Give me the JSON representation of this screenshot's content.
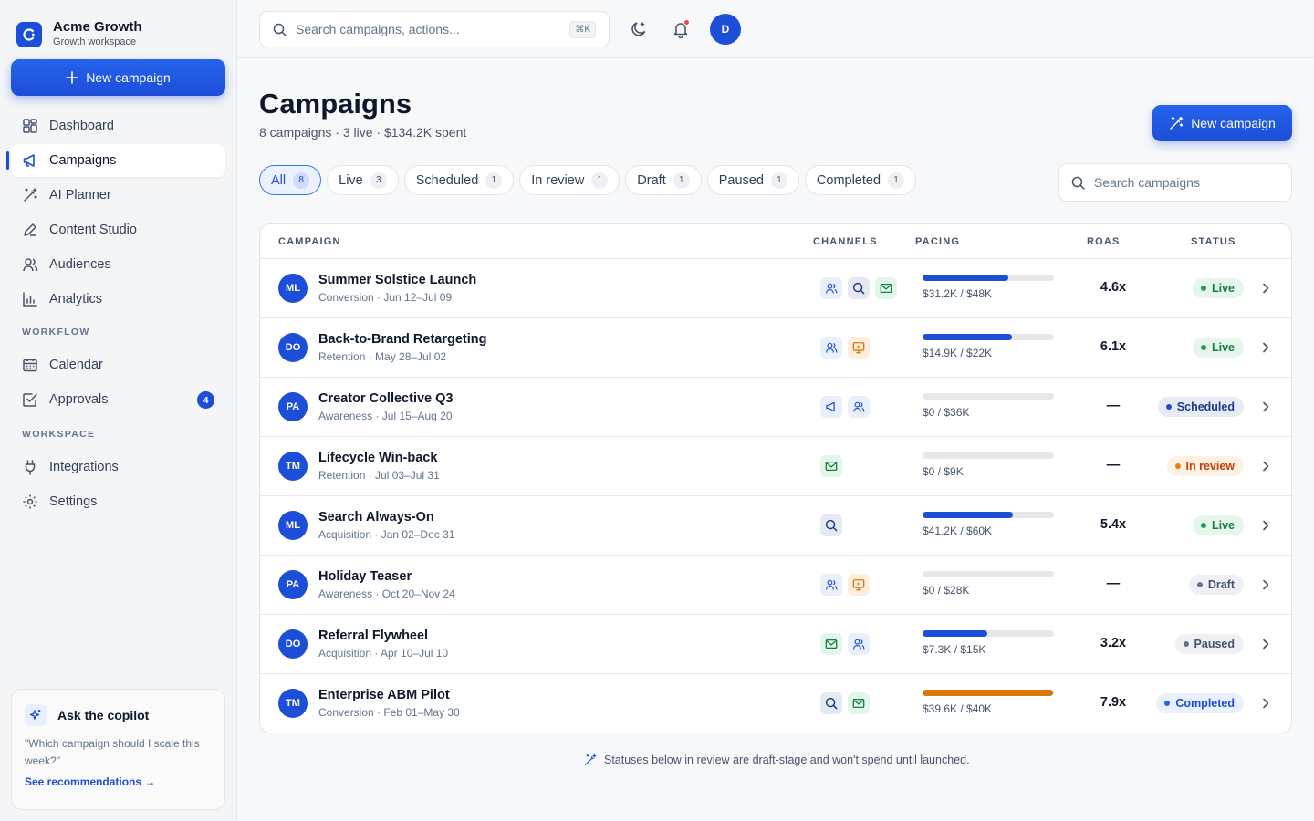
{
  "brand": {
    "name": "Acme Growth",
    "workspace": "Growth workspace"
  },
  "sidebar": {
    "new_campaign_label": "New campaign",
    "main_items": [
      {
        "label": "Dashboard",
        "icon": "dashboard-icon"
      },
      {
        "label": "Campaigns",
        "icon": "megaphone-icon",
        "active": true
      },
      {
        "label": "AI Planner",
        "icon": "magic-wand-icon"
      },
      {
        "label": "Content Studio",
        "icon": "pen-icon"
      },
      {
        "label": "Audiences",
        "icon": "users-icon"
      },
      {
        "label": "Analytics",
        "icon": "bar-chart-icon"
      }
    ],
    "workflow_title": "WORKFLOW",
    "workflow_items": [
      {
        "label": "Calendar",
        "icon": "calendar-icon"
      },
      {
        "label": "Approvals",
        "icon": "check-square-icon",
        "badge": "4"
      }
    ],
    "workspace_title": "WORKSPACE",
    "workspace_items": [
      {
        "label": "Integrations",
        "icon": "plug-icon"
      },
      {
        "label": "Settings",
        "icon": "gear-icon"
      }
    ],
    "copilot": {
      "title": "Ask the copilot",
      "prompt": "\"Which campaign should I scale this week?\"",
      "link": "See recommendations →"
    }
  },
  "topbar": {
    "search_placeholder": "Search campaigns, actions...",
    "shortcut": "⌘K",
    "avatar_initial": "D"
  },
  "page": {
    "title": "Campaigns",
    "subtitle": "8 campaigns · 3 live · $134.2K spent",
    "new_campaign_label": "New campaign",
    "search_placeholder": "Search campaigns"
  },
  "filters": [
    {
      "label": "All",
      "count": "8",
      "active": true
    },
    {
      "label": "Live",
      "count": "3"
    },
    {
      "label": "Scheduled",
      "count": "1"
    },
    {
      "label": "In review",
      "count": "1"
    },
    {
      "label": "Draft",
      "count": "1"
    },
    {
      "label": "Paused",
      "count": "1"
    },
    {
      "label": "Completed",
      "count": "1"
    }
  ],
  "table": {
    "headers": {
      "campaign": "CAMPAIGN",
      "channels": "CHANNELS",
      "pacing": "PACING",
      "roas": "ROAS",
      "status": "STATUS"
    },
    "rows": [
      {
        "initials": "ML",
        "name": "Summer Solstice Launch",
        "meta": "Conversion · Jun 12–Jul 09",
        "channels": [
          "social",
          "search",
          "email"
        ],
        "pacing": 0.65,
        "pacing_text": "$31.2K / $48K",
        "roas": "4.6x",
        "status": "Live",
        "status_key": "live"
      },
      {
        "initials": "DO",
        "name": "Back-to-Brand Retargeting",
        "meta": "Retention · May 28–Jul 02",
        "channels": [
          "social",
          "display"
        ],
        "pacing": 0.68,
        "pacing_text": "$14.9K / $22K",
        "roas": "6.1x",
        "status": "Live",
        "status_key": "live"
      },
      {
        "initials": "PA",
        "name": "Creator Collective Q3",
        "meta": "Awareness · Jul 15–Aug 20",
        "channels": [
          "ads",
          "social"
        ],
        "pacing": 0,
        "pacing_text": "$0 / $36K",
        "roas": "—",
        "status": "Scheduled",
        "status_key": "scheduled"
      },
      {
        "initials": "TM",
        "name": "Lifecycle Win-back",
        "meta": "Retention · Jul 03–Jul 31",
        "channels": [
          "email"
        ],
        "pacing": 0,
        "pacing_text": "$0 / $9K",
        "roas": "—",
        "status": "In review",
        "status_key": "review"
      },
      {
        "initials": "ML",
        "name": "Search Always-On",
        "meta": "Acquisition · Jan 02–Dec 31",
        "channels": [
          "search"
        ],
        "pacing": 0.69,
        "pacing_text": "$41.2K / $60K",
        "roas": "5.4x",
        "status": "Live",
        "status_key": "live"
      },
      {
        "initials": "PA",
        "name": "Holiday Teaser",
        "meta": "Awareness · Oct 20–Nov 24",
        "channels": [
          "social",
          "display"
        ],
        "pacing": 0,
        "pacing_text": "$0 / $28K",
        "roas": "—",
        "status": "Draft",
        "status_key": "draft"
      },
      {
        "initials": "DO",
        "name": "Referral Flywheel",
        "meta": "Acquisition · Apr 10–Jul 10",
        "channels": [
          "email",
          "social"
        ],
        "pacing": 0.49,
        "pacing_text": "$7.3K / $15K",
        "roas": "3.2x",
        "status": "Paused",
        "status_key": "paused"
      },
      {
        "initials": "TM",
        "name": "Enterprise ABM Pilot",
        "meta": "Conversion · Feb 01–May 30",
        "channels": [
          "search",
          "email"
        ],
        "pacing": 0.99,
        "pacing_text": "$39.6K / $40K",
        "roas": "7.9x",
        "status": "Completed",
        "status_key": "completed"
      }
    ]
  },
  "footnote": "Statuses below in review are draft-stage and won't spend until launched.",
  "colors": {
    "accent": "#1d4ed8",
    "live": "#16a34a",
    "review": "#ea7c0c",
    "completed_pacing": "#d97706"
  }
}
